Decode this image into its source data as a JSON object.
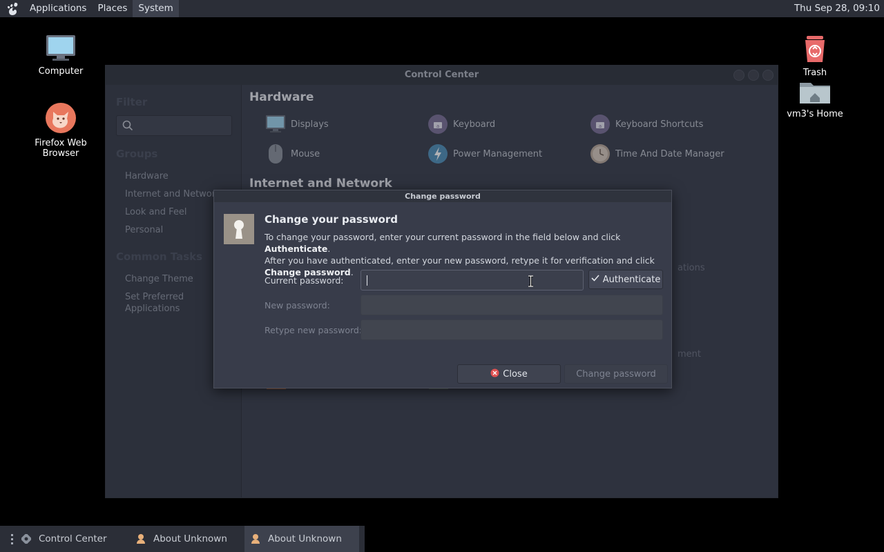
{
  "top_panel": {
    "menus": [
      "Applications",
      "Places",
      "System"
    ],
    "clock": "Thu Sep 28, 09:10"
  },
  "desktop": {
    "icons": [
      {
        "label": "Computer",
        "icon": "computer-icon"
      },
      {
        "label": "Firefox Web Browser",
        "icon": "firefox-icon"
      },
      {
        "label": "Trash",
        "icon": "trash-icon"
      },
      {
        "label": "vm3's Home",
        "icon": "home-folder-icon"
      }
    ]
  },
  "control_center": {
    "title": "Control Center",
    "sidebar": {
      "filter_heading": "Filter",
      "groups_heading": "Groups",
      "groups": [
        "Hardware",
        "Internet and Network",
        "Look and Feel",
        "Personal"
      ],
      "tasks_heading": "Common Tasks",
      "tasks": [
        "Change Theme",
        "Set Preferred Applications"
      ]
    },
    "sections": {
      "hardware": {
        "title": "Hardware",
        "applets": [
          "Displays",
          "Keyboard",
          "Keyboard Shortcuts",
          "Mouse",
          "Power Management",
          "Time And Date Manager"
        ]
      },
      "internet": {
        "title": "Internet and Network",
        "partial_labels": [
          "ations",
          "ment"
        ]
      }
    }
  },
  "dialog": {
    "title": "Change password",
    "heading": "Change your password",
    "text_1": "To change your password, enter your current password in the field below and click ",
    "text_1_bold": "Authenticate",
    "text_2": "After you have authenticated, enter your new password, retype it for verification and click ",
    "text_2_bold": "Change password",
    "current_label": "Current password:",
    "current_value": "",
    "new_label": "New password:",
    "retype_label": "Retype new password:",
    "authenticate_label": "Authenticate",
    "close_label": "Close",
    "change_label": "Change password"
  },
  "taskbar": {
    "tasks": [
      {
        "label": "Control Center",
        "active": false
      },
      {
        "label": "About Unknown",
        "active": false
      },
      {
        "label": "About Unknown",
        "active": true
      }
    ]
  }
}
